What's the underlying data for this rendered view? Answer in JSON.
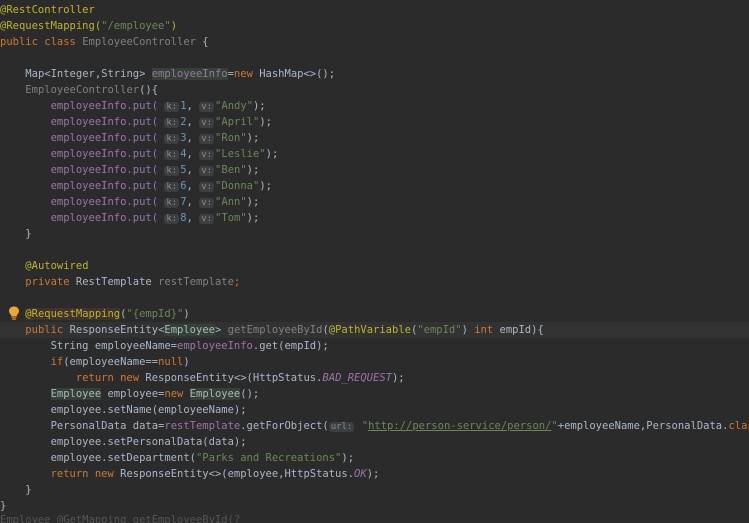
{
  "code": {
    "l1": "@RestController",
    "l2a": "@RequestMapping(",
    "l2b": "\"/employee\"",
    "l2c": ")",
    "l3a": "public class ",
    "l3b": "EmployeeController",
    "l3c": " {",
    "l5a": "Map<Integer,String> ",
    "l5b": "employeeInfo",
    "l5c": "=",
    "l5d": "new ",
    "l5e": "HashMap<>();",
    "l6a": "EmployeeController",
    "l6b": "(){",
    "puts": [
      {
        "k": "1",
        "v": "\"Andy\""
      },
      {
        "k": "2",
        "v": "\"April\""
      },
      {
        "k": "3",
        "v": "\"Ron\""
      },
      {
        "k": "4",
        "v": "\"Leslie\""
      },
      {
        "k": "5",
        "v": "\"Ben\""
      },
      {
        "k": "6",
        "v": "\"Donna\""
      },
      {
        "k": "7",
        "v": "\"Ann\""
      },
      {
        "k": "8",
        "v": "\"Tom\""
      }
    ],
    "put_prefix": "employeeInfo.put(",
    "hint_k": "k:",
    "hint_v": "v:",
    "comma": ", ",
    "put_suffix": ");",
    "close_brace": "}",
    "autowired": "@Autowired",
    "l18a": "private ",
    "l18b": "RestTemplate ",
    "l18c": "restTemplate",
    "l18d": ";",
    "l20a": "@RequestMapping",
    "l20b": "(",
    "l20c": "\"{empId}\"",
    "l20d": ")",
    "l21a": "public ",
    "l21b": "ResponseEntity<",
    "l21c": "Employee",
    "l21d": "> ",
    "l21e": "getEmployeeById",
    "l21f": "(",
    "l21g": "@PathVariable",
    "l21h": "(",
    "l21i": "\"empId\"",
    "l21j": ") ",
    "l21k": "int ",
    "l21l": "empId){",
    "l22a": "String employeeName=",
    "l22b": "employeeInfo",
    "l22c": ".get(empId);",
    "l23a": "if",
    "l23b": "(employeeName==",
    "l23c": "null",
    "l23d": ")",
    "l24a": "return new ",
    "l24b": "ResponseEntity<>(HttpStatus.",
    "l24c": "BAD_REQUEST",
    "l24d": ");",
    "l25a": "Employee",
    "l25b": " employee=",
    "l25c": "new ",
    "l25d": "Employee",
    "l25e": "();",
    "l26": "employee.setName(employeeName);",
    "l27a": "PersonalData data=",
    "l27b": "restTemplate",
    "l27c": ".getForObject(",
    "l27d": "url:",
    "l27e": " \"",
    "l27f": "http://person-service/person/",
    "l27g": "\"",
    "l27h": "+employeeName,PersonalData.",
    "l27i": "class",
    "l27j": ");",
    "l28": "employee.setPersonalData(data);",
    "l29a": "employee.setDepartment(",
    "l29b": "\"Parks and Recreations\"",
    "l29c": ");",
    "l30a": "return new ",
    "l30b": "ResponseEntity<>(employee,HttpStatus.",
    "l30c": "OK",
    "l30d": ");",
    "cut": "    Employee  @GetMapping  getEmployeeById(?"
  },
  "colors": {
    "background": "#2b2b2b",
    "keyword": "#cc7832",
    "annotation": "#bbb529",
    "string": "#6a8759",
    "number": "#6897bb",
    "field": "#9876aa"
  },
  "icons": {
    "gutter": "lightbulb-icon"
  }
}
